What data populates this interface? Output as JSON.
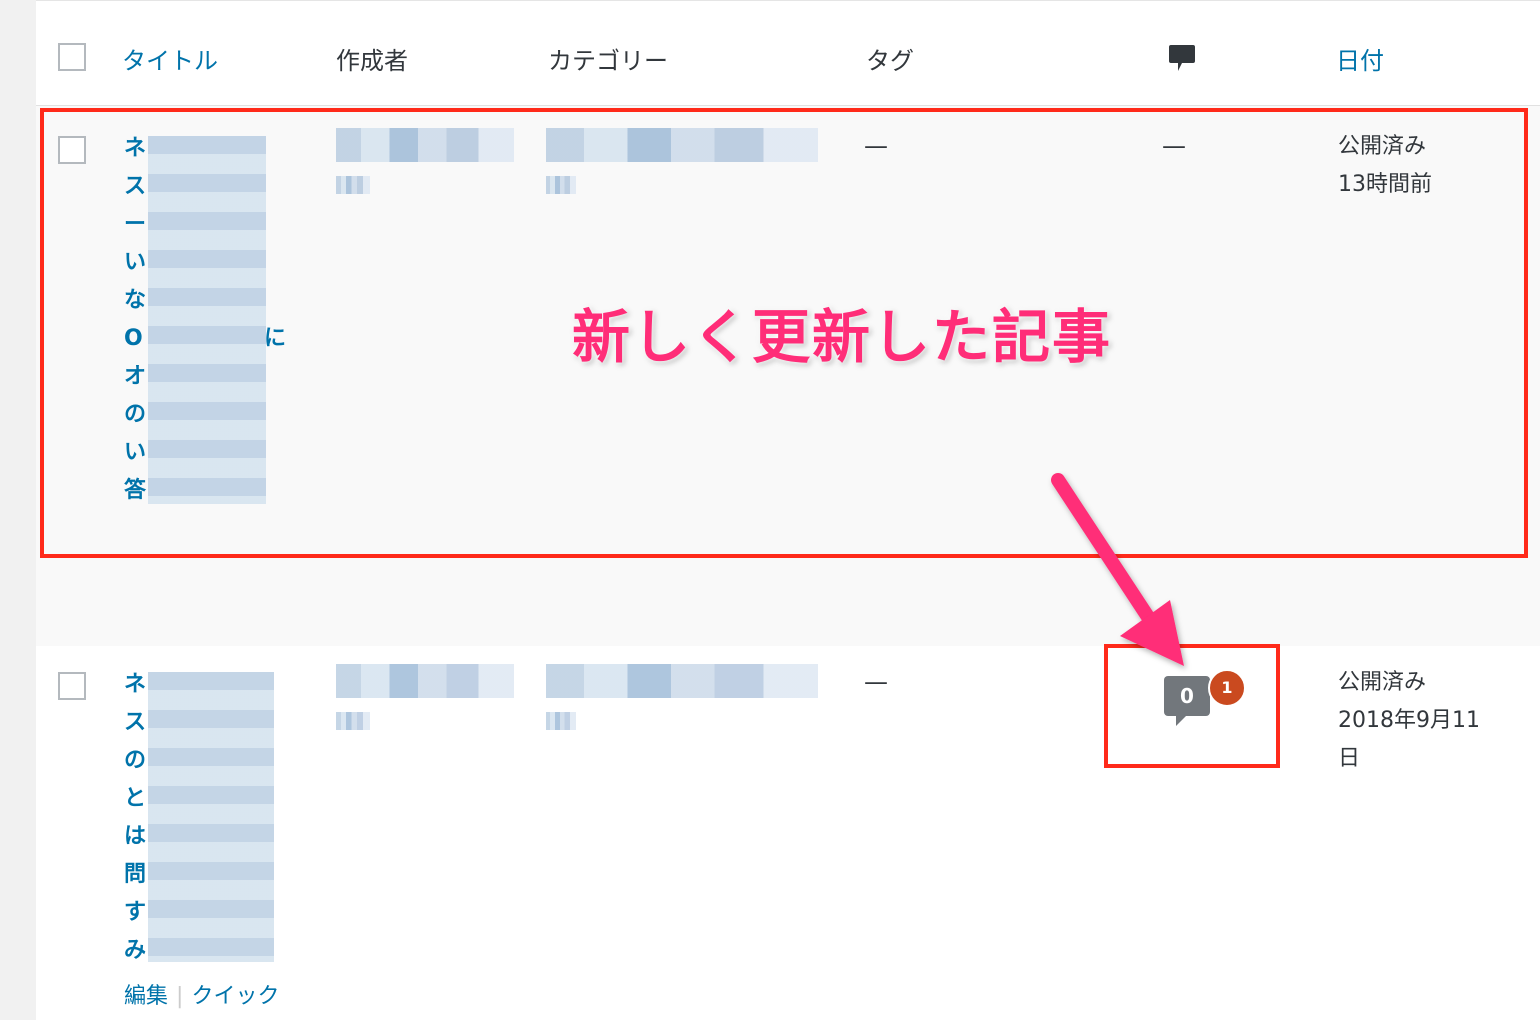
{
  "header": {
    "title": "タイトル",
    "author": "作成者",
    "categories": "カテゴリー",
    "tags": "タグ",
    "comments_icon": "comment-icon",
    "date": "日付"
  },
  "rows": [
    {
      "title_lines": [
        "ネ",
        "ス",
        "ー",
        "い",
        "な",
        "O",
        "オ",
        "の",
        "い",
        "答"
      ],
      "title_tail": [
        "",
        "",
        "",
        "",
        "",
        "に",
        "",
        "",
        "",
        ""
      ],
      "tags": "—",
      "comments": "—",
      "status": "公開済み",
      "date": "13時間前"
    },
    {
      "title_lines": [
        "ネ",
        "ス",
        "の",
        "と",
        "は",
        "問",
        "す",
        "み"
      ],
      "tags": "—",
      "comments_approved": "0",
      "comments_pending": "1",
      "status": "公開済み",
      "date_line1": "2018年9月11",
      "date_line2": "日",
      "actions": {
        "edit": "編集",
        "sep": "|",
        "quick": "クイック"
      }
    }
  ],
  "annotation": {
    "text": "新しく更新した記事"
  },
  "colors": {
    "link": "#0073aa",
    "highlight_box": "#ff2a1a",
    "annotation": "#ff2d78",
    "arrow": "#ff2d78",
    "pending_badge": "#ca4a1f"
  }
}
